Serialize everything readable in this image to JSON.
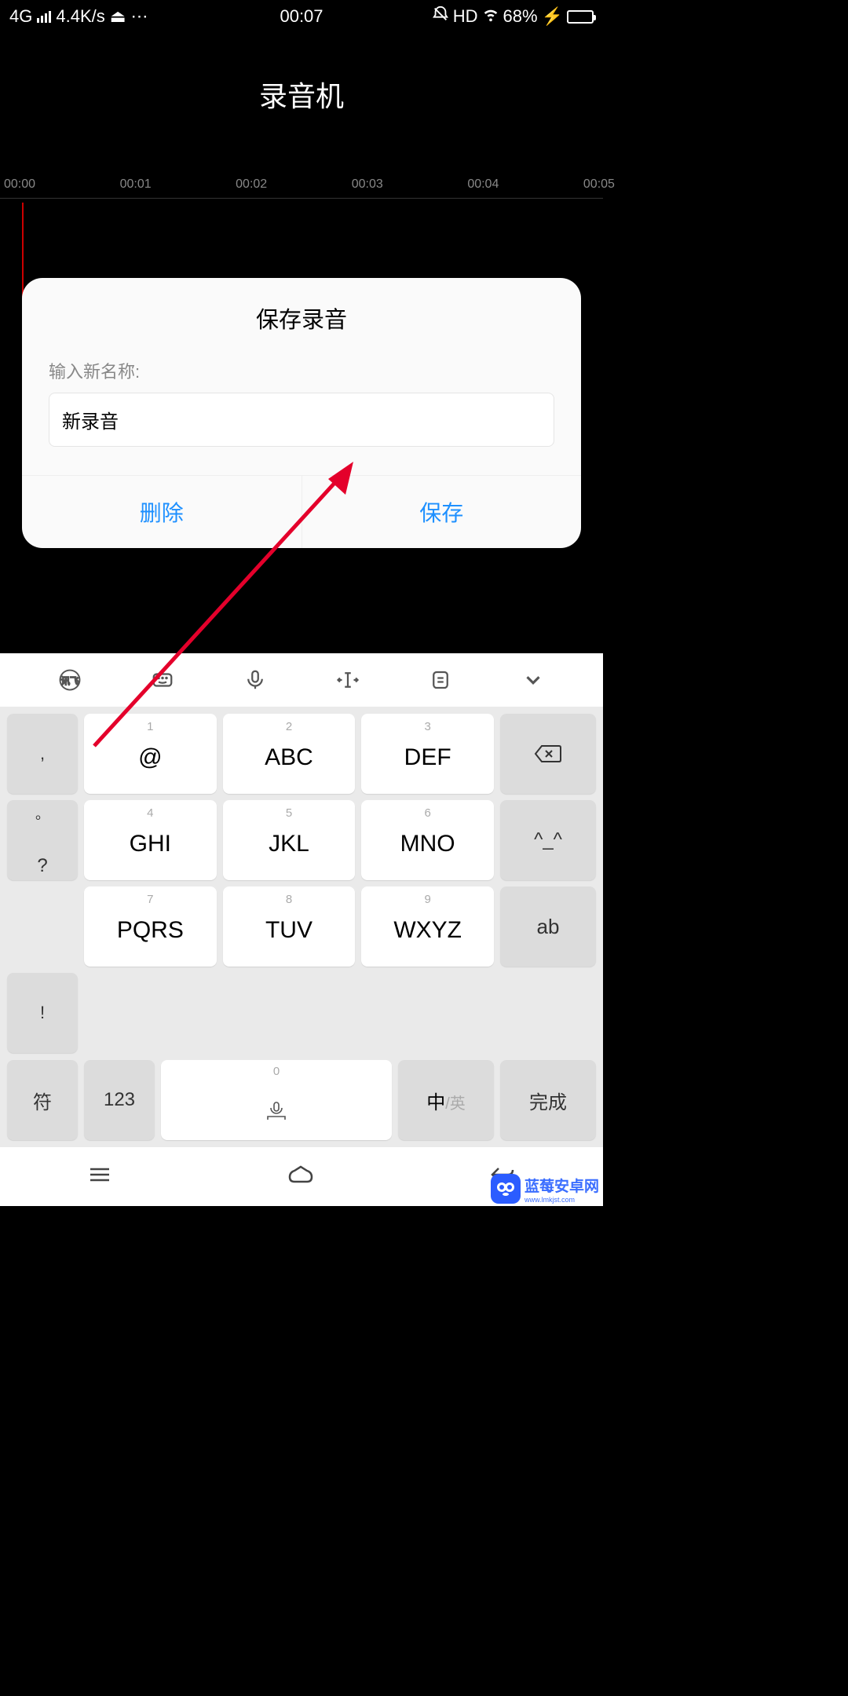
{
  "status": {
    "network": "4G",
    "speed": "4.4K/s",
    "time": "00:07",
    "hd": "HD",
    "battery_pct": "68%"
  },
  "app": {
    "title": "录音机"
  },
  "timeline": {
    "marks": [
      "00:00",
      "00:01",
      "00:02",
      "00:03",
      "00:04",
      "00:05"
    ]
  },
  "dialog": {
    "title": "保存录音",
    "label": "输入新名称:",
    "input_value": "新录音",
    "delete_btn": "删除",
    "save_btn": "保存"
  },
  "keyboard": {
    "keys": [
      {
        "num": "1",
        "label": "@"
      },
      {
        "num": "2",
        "label": "ABC"
      },
      {
        "num": "3",
        "label": "DEF"
      },
      {
        "num": "4",
        "label": "GHI"
      },
      {
        "num": "5",
        "label": "JKL"
      },
      {
        "num": "6",
        "label": "MNO"
      },
      {
        "num": "7",
        "label": "PQRS"
      },
      {
        "num": "8",
        "label": "TUV"
      },
      {
        "num": "9",
        "label": "WXYZ"
      }
    ],
    "side_left": [
      ",",
      "。",
      "?",
      "!"
    ],
    "side_right_emoji": "^_^",
    "side_right_ab": "ab",
    "bottom": {
      "sym": "符",
      "num": "123",
      "space_num": "0",
      "cn": "中",
      "en": "/英",
      "done": "完成"
    }
  },
  "watermark": {
    "name": "蓝莓安卓网",
    "url": "www.lmkjst.com"
  }
}
